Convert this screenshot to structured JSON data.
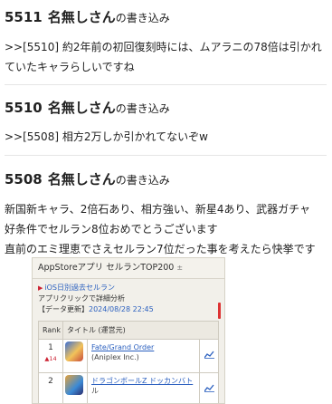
{
  "posts": [
    {
      "number": "5511",
      "name": "名無しさん",
      "suffix": "の書き込み",
      "lines": [
        ">>[5510] 約2年前の初回復刻時には、ムアラニの78倍は引かれ",
        "ていたキャラらしいですね"
      ]
    },
    {
      "number": "5510",
      "name": "名無しさん",
      "suffix": "の書き込み",
      "lines": [
        ">>[5508] 相方2万しか引かれてないぞw"
      ]
    },
    {
      "number": "5508",
      "name": "名無しさん",
      "suffix": "の書き込み",
      "lines": [
        "新国新キャラ、2倍石あり、相方強い、新星4あり、武器ガチャ",
        "好条件でセルラン8位おめでとうございます",
        "直前のエミ理恵でさえセルラン7位だった事を考えたら快挙です"
      ]
    }
  ],
  "screenshot": {
    "header": "AppStoreアプリ セルランTOP200",
    "header_ext": "±",
    "link": "iOS日別過去セルラン",
    "note": "アプリクリックで詳細分析",
    "update_label": "【データ更新】",
    "update_time": "2024/08/28 22:45",
    "columns": [
      "Rank",
      "タイトル (運営元)"
    ],
    "rows": [
      {
        "rank": "1",
        "delta": "▲14",
        "title": "Fate/Grand Order",
        "company": "(Aniplex Inc.)",
        "icon": "fgo"
      },
      {
        "rank": "2",
        "delta": "",
        "title": "ドラゴンボールZ ドッカンバト",
        "company": "ル",
        "icon": "dbz"
      }
    ]
  }
}
